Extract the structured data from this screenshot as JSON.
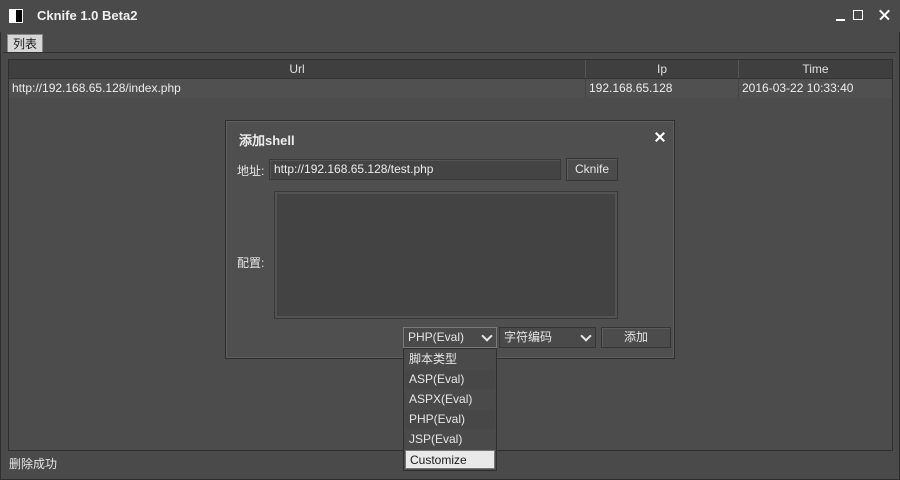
{
  "window": {
    "title": "Cknife 1.0 Beta2"
  },
  "tabs": [
    {
      "label": "列表"
    }
  ],
  "table": {
    "headers": [
      "Url",
      "Ip",
      "Time"
    ],
    "rows": [
      {
        "url": "http://192.168.65.128/index.php",
        "ip": "192.168.65.128",
        "time": "2016-03-22 10:33:40"
      }
    ]
  },
  "status": {
    "text": "删除成功"
  },
  "dialog": {
    "title": "添加shell",
    "address_label": "地址:",
    "address_value": "http://192.168.65.128/test.php",
    "cknife_button": "Cknife",
    "config_label": "配置:",
    "config_value": "",
    "script_type_selected": "PHP(Eval)",
    "encoding_selected": "字符编码",
    "add_button": "添加"
  },
  "dropdown": {
    "options": [
      "脚本类型",
      "ASP(Eval)",
      "ASPX(Eval)",
      "PHP(Eval)",
      "JSP(Eval)",
      "Customize"
    ],
    "highlighted": "Customize"
  }
}
